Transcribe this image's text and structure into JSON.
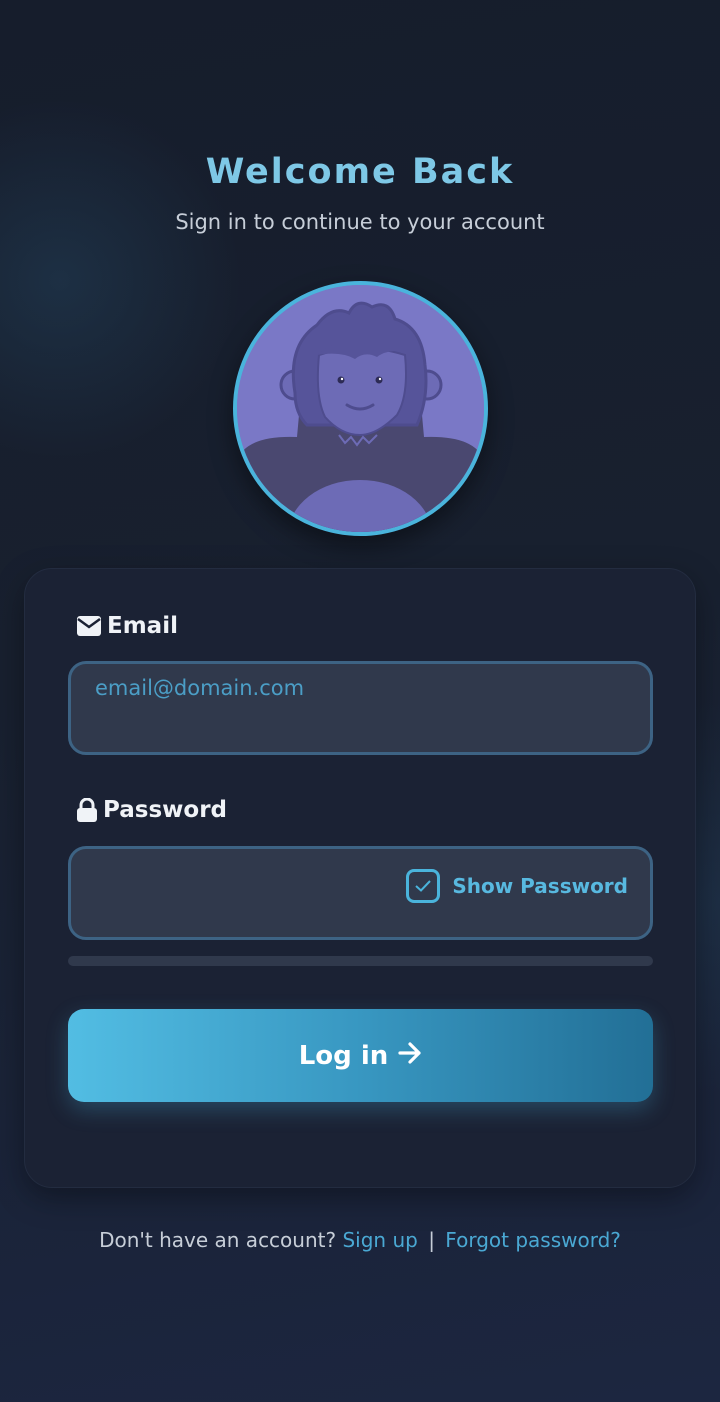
{
  "header": {
    "title": "Welcome Back",
    "subtitle": "Sign in to continue to your account"
  },
  "avatar": {
    "icon": "gorilla-avatar-icon"
  },
  "form": {
    "email_label": "Email",
    "email_icon": "envelope-icon",
    "email_placeholder": "email@domain.com",
    "email_value": "",
    "password_label": "Password",
    "password_icon": "lock-icon",
    "password_value": "",
    "show_password_label": "Show Password",
    "show_password_checked": true,
    "login_label": "Log in",
    "login_icon": "arrow-right-icon"
  },
  "footer": {
    "prompt": "Don't have an account?",
    "signup_link": "Sign up",
    "separator": "|",
    "forgot_link": "Forgot password?"
  },
  "colors": {
    "accent": "#4ab4dc",
    "title": "#7ec8e6",
    "background": "#18202f",
    "card": "#1b2234"
  }
}
